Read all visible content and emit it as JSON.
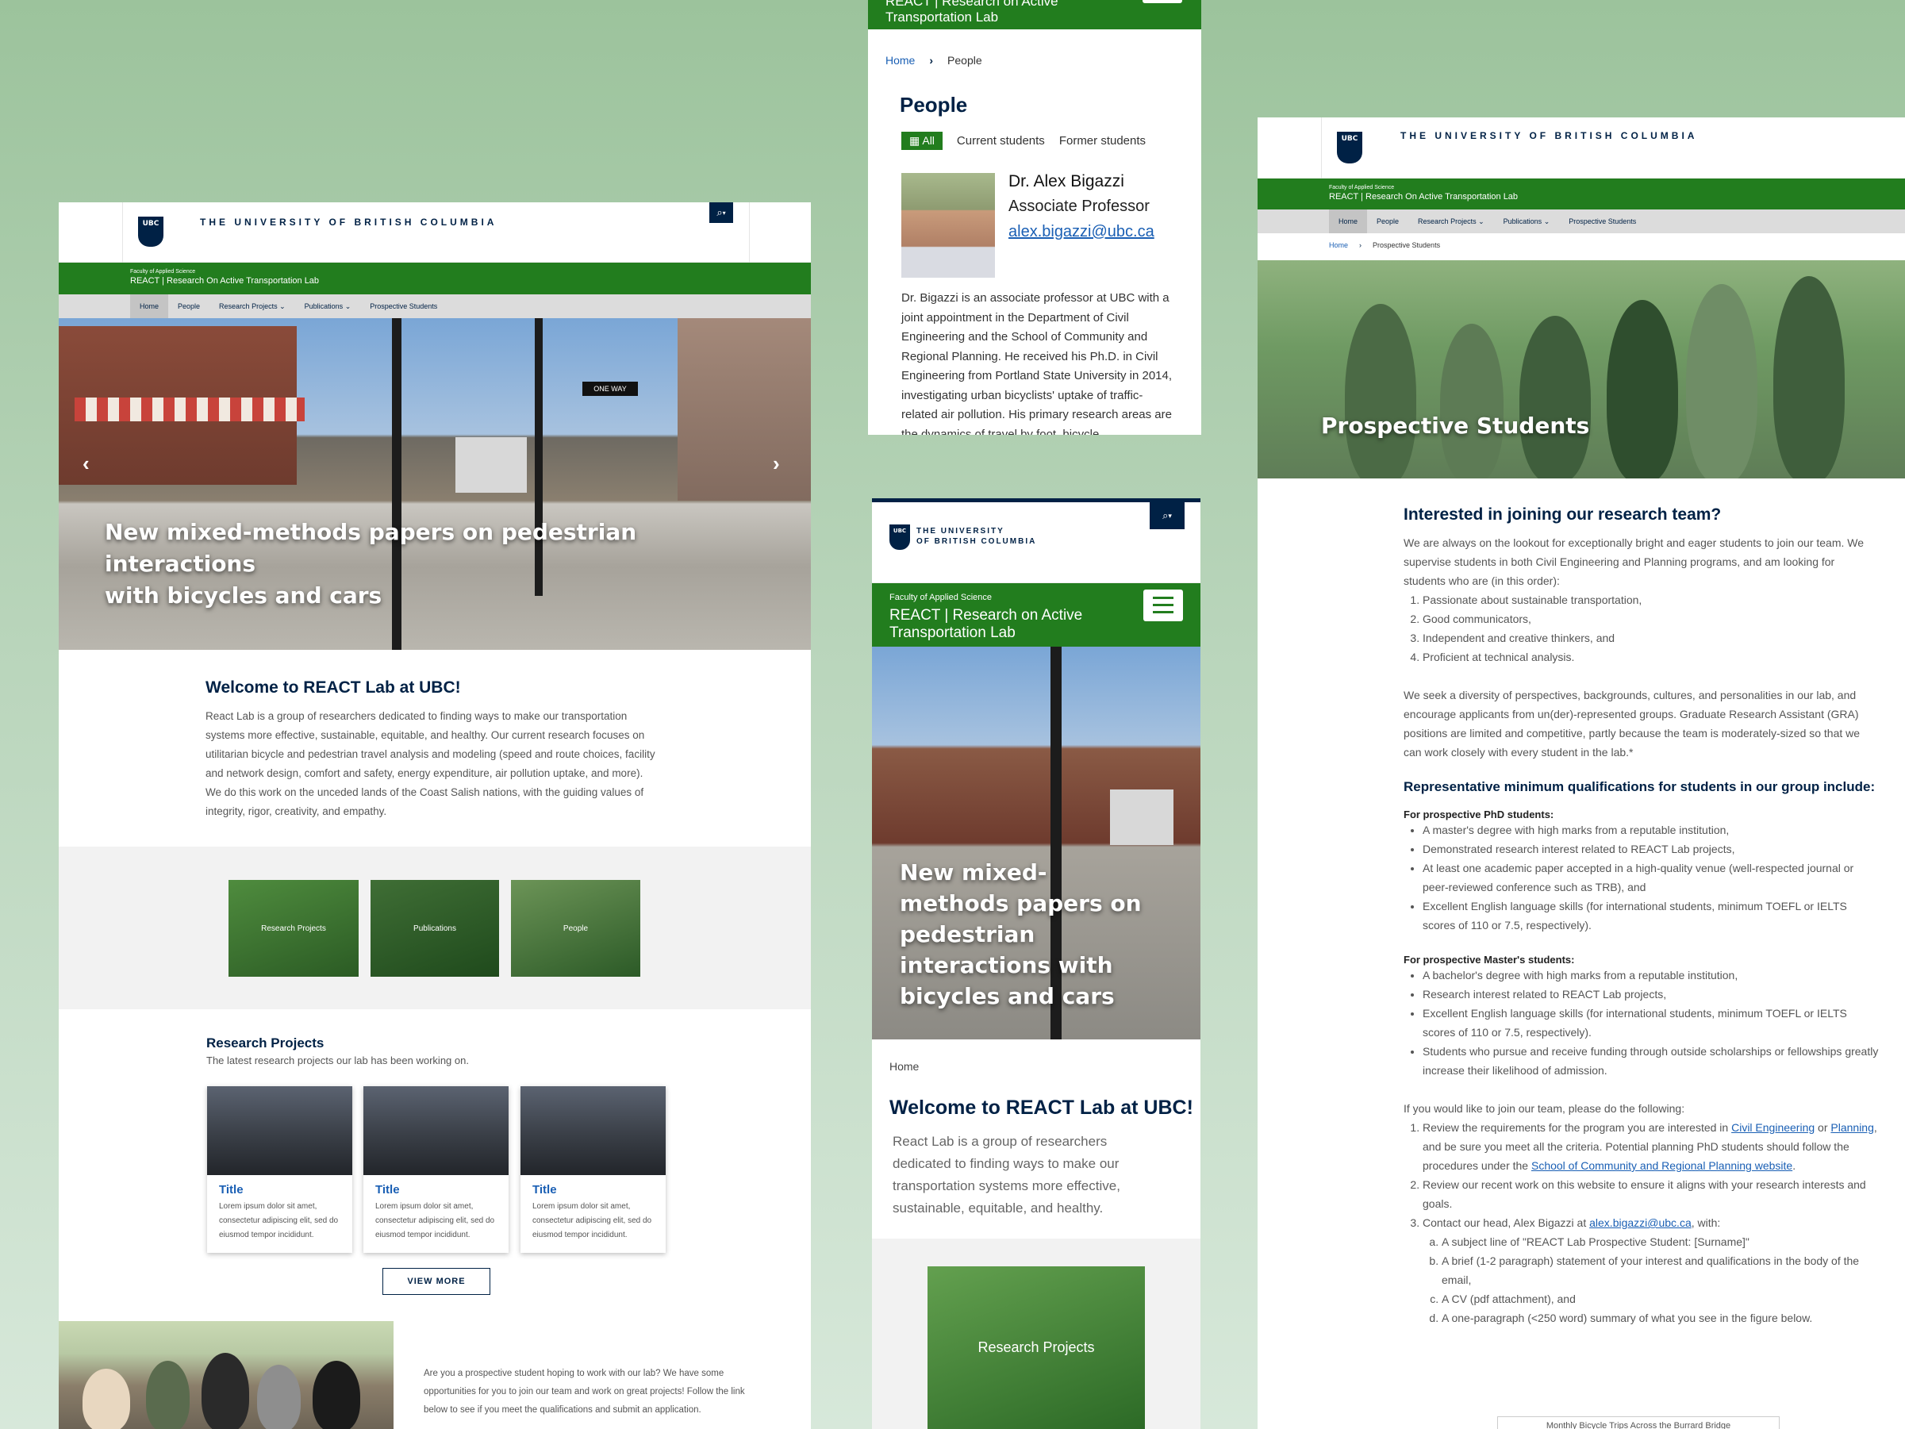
{
  "ubc": {
    "name": "THE UNIVERSITY OF BRITISH COLUMBIA",
    "name_line1": "THE UNIVERSITY",
    "name_line2": "OF BRITISH COLUMBIA",
    "crest": "UBC"
  },
  "lab": {
    "faculty": "Faculty of Applied Science",
    "name": "REACT | Research On Active Transportation Lab",
    "name_mobile_1": "REACT | Research on Active",
    "name_mobile_2": "Transportation Lab"
  },
  "nav": [
    {
      "label": "Home",
      "active": true
    },
    {
      "label": "People"
    },
    {
      "label": "Research Projects",
      "dropdown": true
    },
    {
      "label": "Publications",
      "dropdown": true
    },
    {
      "label": "Prospective Students"
    }
  ],
  "home": {
    "hero_title": "New mixed-methods papers on pedestrian interactions with bicycles and cars",
    "hero_line1": "New mixed-methods papers on pedestrian interactions",
    "hero_line2": "with bicycles and cars",
    "welcome_title": "Welcome to REACT Lab at UBC!",
    "welcome_text": "React Lab is a group of researchers dedicated to finding ways to make our transportation systems more effective, sustainable, equitable, and healthy. Our current research focuses on utilitarian bicycle and pedestrian travel analysis and modeling (speed and route choices, facility and network design, comfort and safety, energy expenditure, air pollution uptake, and more). We do this work on the unceded lands of the Coast Salish nations, with the guiding values of integrity, rigor, creativity, and empathy.",
    "tiles": [
      "Research Projects",
      "Publications",
      "People"
    ],
    "projects_title": "Research Projects",
    "projects_sub": "The latest research projects our lab has been working on.",
    "cards": [
      {
        "title": "Title",
        "text": "Lorem ipsum dolor sit amet, consectetur adipiscing elit, sed do eiusmod tempor incididunt."
      },
      {
        "title": "Title",
        "text": "Lorem ipsum dolor sit amet, consectetur adipiscing elit, sed do eiusmod tempor incididunt."
      },
      {
        "title": "Title",
        "text": "Lorem ipsum dolor sit amet, consectetur adipiscing elit, sed do eiusmod tempor incididunt."
      }
    ],
    "view_more": "VIEW MORE",
    "prospective_text": "Are you a prospective student hoping to work with our lab? We have some opportunities for you to join our team and work on great projects! Follow the link below to see if you meet the qualifications and submit an application."
  },
  "people": {
    "breadcrumb_home": "Home",
    "breadcrumb_sep": "›",
    "breadcrumb_current": "People",
    "title": "People",
    "filters": [
      "All",
      "Current students",
      "Former students"
    ],
    "person_name": "Dr. Alex Bigazzi",
    "person_role": "Associate Professor",
    "person_email": "alex.bigazzi@ubc.ca",
    "bio": "Dr. Bigazzi is an associate professor at UBC with a joint appointment in the Department of Civil Engineering and the School of Community and Regional Planning. He received his Ph.D. in Civil Engineering from Portland State University in 2014, investigating urban bicyclists' uptake of traffic-related air pollution. His primary research areas are the dynamics of travel by foot, bicycle"
  },
  "mobile": {
    "hero_title": "New mixed-methods papers on pedestrian interactions with bicycles and cars",
    "breadcrumb": "Home",
    "welcome_title": "Welcome to REACT Lab at UBC!",
    "welcome_text": "React Lab is a group of researchers dedicated to finding ways to make our transportation systems more effective, sustainable, equitable, and healthy.",
    "tile": "Research Projects"
  },
  "prospective": {
    "breadcrumb_home": "Home",
    "breadcrumb_current": "Prospective Students",
    "hero_title": "Prospective Students",
    "h_join": "Interested in joining our research team?",
    "intro": "We are always on the lookout for exceptionally bright and eager students to join our team. We supervise students in both Civil Engineering and Planning programs, and am looking for students who are (in this order):",
    "traits": [
      "Passionate about sustainable transportation,",
      "Good communicators,",
      "Independent and creative thinkers, and",
      "Proficient at technical analysis."
    ],
    "diversity": "We seek a diversity of perspectives, backgrounds, cultures, and personalities in our lab, and encourage applicants from un(der)-represented groups. Graduate Research Assistant (GRA) positions are limited and competitive, partly because the team is moderately-sized so that we can work closely with every student in the lab.*",
    "h_quals": "Representative minimum qualifications for students in our group include:",
    "h_phd": "For prospective PhD students:",
    "phd": [
      "A master's degree with high marks from a reputable institution,",
      "Demonstrated research interest related to REACT Lab projects,",
      "At least one academic paper accepted in a high-quality venue (well-respected journal or peer-reviewed conference such as TRB), and",
      "Excellent English language skills (for international students, minimum TOEFL or IELTS scores of 110 or 7.5, respectively)."
    ],
    "h_masters": "For prospective Master's students:",
    "masters": [
      "A bachelor's degree with high marks from a reputable institution,",
      "Research interest related to REACT Lab projects,",
      "Excellent English language skills (for international students, minimum TOEFL or IELTS scores of 110 or 7.5, respectively).",
      "Students who pursue and receive funding through outside scholarships or fellowships greatly increase their likelihood of admission."
    ],
    "join_intro": "If you would like to join our team, please do the following:",
    "step1_a": "Review the requirements for the program you are interested in ",
    "step1_link1": "Civil Engineering",
    "step1_or": " or ",
    "step1_link2": "Planning",
    "step1_b": ", and be sure you meet all the criteria. Potential planning PhD students should follow the procedures under the ",
    "step1_link3": "School of Community and Regional Planning website",
    "step1_end": ".",
    "step2": "Review our recent work on this website to ensure it aligns with your research interests and goals.",
    "step3_a": "Contact our head, Alex Bigazzi at ",
    "step3_email": "alex.bigazzi@ubc.ca",
    "step3_b": ", with:",
    "sub": [
      "A subject line of \"REACT Lab Prospective Student: [Surname]\"",
      "A brief (1-2 paragraph) statement of your interest and qualifications in the body of the email,",
      "A CV (pdf attachment), and",
      "A one-paragraph (<250 word) summary of what you see in the figure below."
    ],
    "cut_caption": "Monthly Bicycle Trips Across the Burrard Bridge"
  },
  "icons": {
    "search": "search-icon",
    "chevron_down": "chevron-down-icon",
    "menu": "hamburger-menu-icon",
    "prev": "chevron-left-icon",
    "next": "chevron-right-icon",
    "grid": "grid-icon"
  },
  "colors": {
    "ubc_blue": "#002145",
    "lab_green": "#227d1e",
    "link": "#1a5fb4",
    "bg_green": "#9cc39c"
  }
}
